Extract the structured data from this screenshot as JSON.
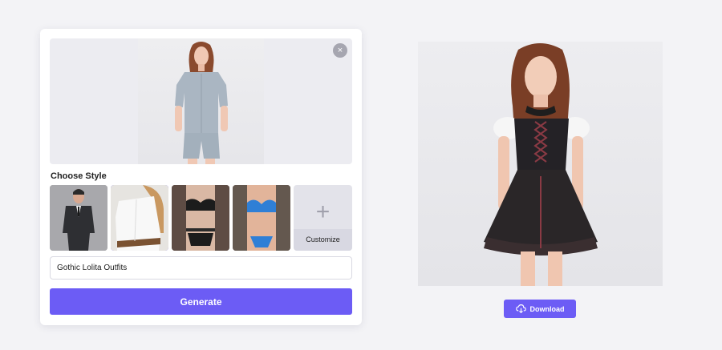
{
  "upload": {
    "photo_alt": "Woman in grey shirt and shorts",
    "close_icon": "×"
  },
  "style_section": {
    "label": "Choose Style",
    "thumbnails": [
      {
        "name": "black-suit",
        "selected": false
      },
      {
        "name": "white-blouse",
        "selected": true
      },
      {
        "name": "black-lace-lingerie",
        "selected": false
      },
      {
        "name": "blue-bikini",
        "selected": false
      }
    ],
    "customize_label": "Customize",
    "customize_icon": "+"
  },
  "prompt": {
    "value": "Gothic Lolita Outfits"
  },
  "generate_label": "Generate",
  "result": {
    "image_alt": "Woman in black gothic lolita dress"
  },
  "download_label": "Download",
  "colors": {
    "accent": "#6c5cf5",
    "background": "#f3f3f6",
    "card": "#ffffff"
  }
}
